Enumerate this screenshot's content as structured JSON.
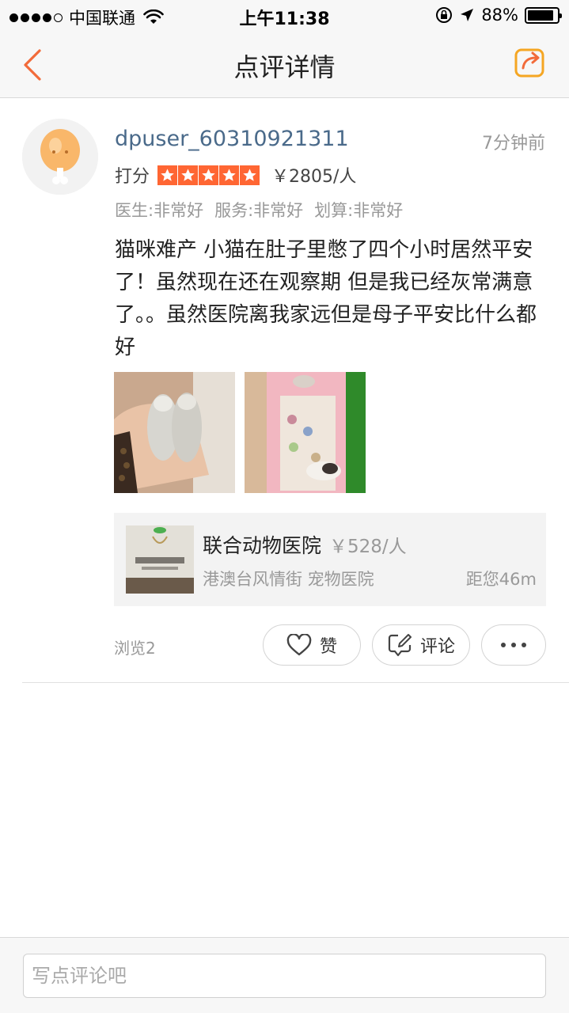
{
  "status_bar": {
    "carrier": "中国联通",
    "time": "上午11:38",
    "battery": "88%",
    "battery_level": 0.88
  },
  "nav": {
    "title": "点评详情"
  },
  "review": {
    "username": "dpuser_60310921311",
    "time_ago": "7分钟前",
    "rating_label": "打分",
    "stars": 5,
    "price": "￥2805/人",
    "scores": [
      "医生:非常好",
      "服务:非常好",
      "划算:非常好"
    ],
    "text": "猫咪难产 小猫在肚子里憋了四个小时居然平安了！虽然现在还在观察期 但是我已经灰常满意了。。虽然医院离我家远但是母子平安比什么都好"
  },
  "shop": {
    "name": "联合动物医院",
    "price": "￥528/人",
    "meta": "港澳台风情街 宠物医院",
    "distance": "距您46m"
  },
  "actions": {
    "views": "浏览2",
    "like_label": "赞",
    "comment_label": "评论"
  },
  "bottom": {
    "placeholder": "写点评论吧"
  },
  "colors": {
    "accent": "#ff6633",
    "username": "#4a6a8a"
  }
}
